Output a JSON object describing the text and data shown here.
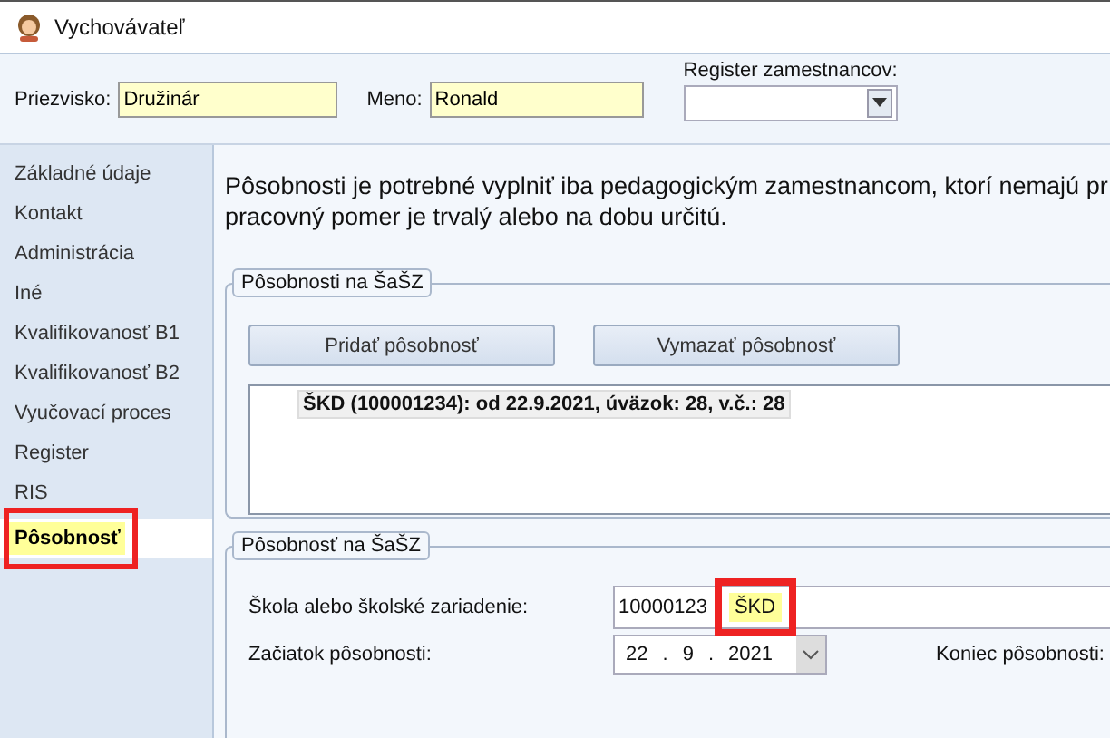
{
  "window": {
    "title": "Vychovávateľ"
  },
  "header": {
    "surname": {
      "label": "Priezvisko:",
      "value": "Družinár"
    },
    "first_name": {
      "label": "Meno:",
      "value": "Ronald"
    },
    "register": {
      "label": "Register zamestnancov:"
    }
  },
  "sidebar": {
    "items": [
      {
        "label": "Základné údaje",
        "selected": false,
        "annotated": false
      },
      {
        "label": "Kontakt",
        "selected": false,
        "annotated": false
      },
      {
        "label": "Administrácia",
        "selected": false,
        "annotated": false
      },
      {
        "label": "Iné",
        "selected": false,
        "annotated": false
      },
      {
        "label": "Kvalifikovanosť B1",
        "selected": false,
        "annotated": false
      },
      {
        "label": "Kvalifikovanosť B2",
        "selected": false,
        "annotated": false
      },
      {
        "label": "Vyučovací proces",
        "selected": false,
        "annotated": false
      },
      {
        "label": "Register",
        "selected": false,
        "annotated": false
      },
      {
        "label": "RIS",
        "selected": false,
        "annotated": false
      },
      {
        "label": "Pôsobnosť",
        "selected": true,
        "annotated": true
      }
    ]
  },
  "content": {
    "note": [
      "Pôsobnosti je potrebné vyplniť iba pedagogickým zamestnancom, ktorí nemajú pr",
      "pracovný pomer je trvalý alebo na dobu určitú."
    ],
    "list_group": {
      "title": "Pôsobnosti na ŠaŠZ",
      "buttons": [
        "Pridať pôsobnosť",
        "Vymazať pôsobnosť"
      ],
      "items": [
        {
          "text": "ŠKD (100001234): od 22.9.2021, úväzok: 28, v.č.: 28",
          "selected": true
        }
      ]
    },
    "detail_group": {
      "title": "Pôsobnosť na ŠaŠZ",
      "school": {
        "label": "Škola alebo školské zariadenie:",
        "code": "10000123",
        "name": "ŠKD",
        "annotated": true
      },
      "start": {
        "label": "Začiatok pôsobnosti:",
        "day": "22",
        "month": "9",
        "year": "2021",
        "separator": "."
      },
      "end": {
        "label": "Koniec pôsobnosti:"
      }
    }
  }
}
